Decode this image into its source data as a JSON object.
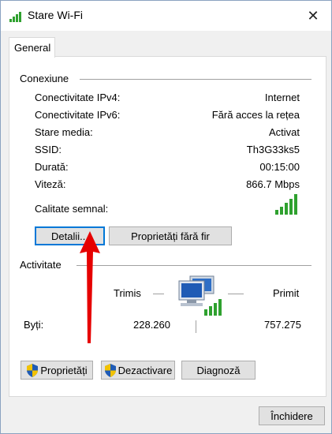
{
  "window": {
    "title": "Stare Wi-Fi",
    "close_glyph": "✕"
  },
  "tabs": [
    {
      "label": "General"
    }
  ],
  "connection": {
    "group_title": "Conexiune",
    "rows": [
      {
        "label": "Conectivitate IPv4:",
        "value": "Internet"
      },
      {
        "label": "Conectivitate IPv6:",
        "value": "Fără acces la rețea"
      },
      {
        "label": "Stare media:",
        "value": "Activat"
      },
      {
        "label": "SSID:",
        "value": "Th3G33ks5"
      },
      {
        "label": "Durată:",
        "value": "00:15:00"
      },
      {
        "label": "Viteză:",
        "value": "866.7 Mbps"
      }
    ],
    "signal_label": "Calitate semnal:",
    "signal_icon": "signal-bars-icon",
    "details_button": "Detalii...",
    "wireless_props_button": "Proprietăți fără fir"
  },
  "activity": {
    "group_title": "Activitate",
    "sent_label": "Trimis",
    "received_label": "Primit",
    "bytes_label": "Byți:",
    "bytes_sent": "228.260",
    "bytes_received": "757.275",
    "network_icon": "network-computers-icon"
  },
  "actions": {
    "properties_button": "Proprietăți",
    "disable_button": "Dezactivare",
    "diagnose_button": "Diagnoză"
  },
  "footer": {
    "close_button": "Închidere"
  },
  "colors": {
    "accent": "#0078d7",
    "signal_green": "#2fa12f",
    "arrow_red": "#e60000"
  }
}
